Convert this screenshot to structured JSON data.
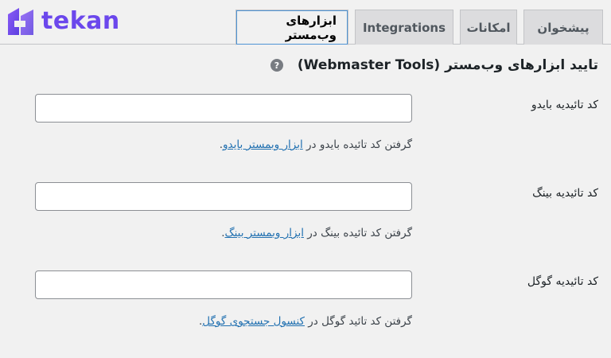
{
  "brand": {
    "name": "tekan",
    "accent": "#6b47ec"
  },
  "tabs": [
    {
      "label": "پیشخوان",
      "active": false
    },
    {
      "label": "امکانات",
      "active": false
    },
    {
      "label": "Integrations",
      "active": false
    },
    {
      "label": "ابزارهای وب‌مستر",
      "active": true
    }
  ],
  "section": {
    "title": "تایید ابزارهای وب‌مستر (Webmaster Tools)",
    "help_icon": "?"
  },
  "fields": [
    {
      "label": "کد تائیدیه بایدو",
      "value": "",
      "desc_prefix": "گرفتن کد تائیده بایدو در ",
      "link_text": "ابزار وبمستر بایدو",
      "desc_suffix": "."
    },
    {
      "label": "کد تائیدیه بینگ",
      "value": "",
      "desc_prefix": "گرفتن کد تائیده بینگ در ",
      "link_text": "ابزار وبمستر بینگ",
      "desc_suffix": "."
    },
    {
      "label": "کد تائیدیه گوگل",
      "value": "",
      "desc_prefix": "گرفتن کد تائید گوگل در ",
      "link_text": "کنسول جستجوی گوگل",
      "desc_suffix": "."
    }
  ]
}
